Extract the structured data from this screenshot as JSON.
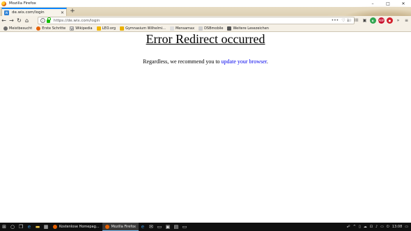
{
  "window": {
    "title": "Mozilla Firefox",
    "controls": [
      "–",
      "□",
      "✕"
    ]
  },
  "tabs": [
    {
      "label": "de.wix.com/login",
      "close": "✕"
    }
  ],
  "new_tab_label": "+",
  "nav": {
    "back": "←",
    "forward": "→",
    "reload": "↻",
    "home": "⌂",
    "url": "https://de.wix.com/login",
    "url_more": "•••",
    "pocket": "♡",
    "star": "☆"
  },
  "toolbar_icons": [
    "↓",
    "ⅠⅠⅠ",
    "▣",
    "◐",
    "ABP",
    "●",
    "»",
    "≡"
  ],
  "bookmarks": [
    {
      "label": "Meistbesucht",
      "color": "#6c6c6c"
    },
    {
      "label": "Erste Schritte",
      "color": "#e66000"
    },
    {
      "label": "Wikipedia",
      "color": "#ffffff"
    },
    {
      "label": "LEO.org",
      "color": "#f2b600"
    },
    {
      "label": "Gymnasium Wilhelmi...",
      "color": "#e9b000"
    },
    {
      "label": "Mensamax",
      "color": "#dddddd"
    },
    {
      "label": "DSBmobile",
      "color": "#cccccc"
    },
    {
      "label": "Weitere Lesezeichen",
      "color": "#555555"
    }
  ],
  "page": {
    "heading": "Error Redirect occurred",
    "message_prefix": "Regardless, we recommend you to ",
    "link_text": "update your browser",
    "message_suffix": "."
  },
  "taskbar": {
    "apps": [
      {
        "label": "Kostenlose Homepag...",
        "color": "#1e5fb4",
        "active": false
      },
      {
        "label": "Mozilla Firefox",
        "color": "#e66000",
        "active": true
      }
    ],
    "clock": "13:08"
  }
}
